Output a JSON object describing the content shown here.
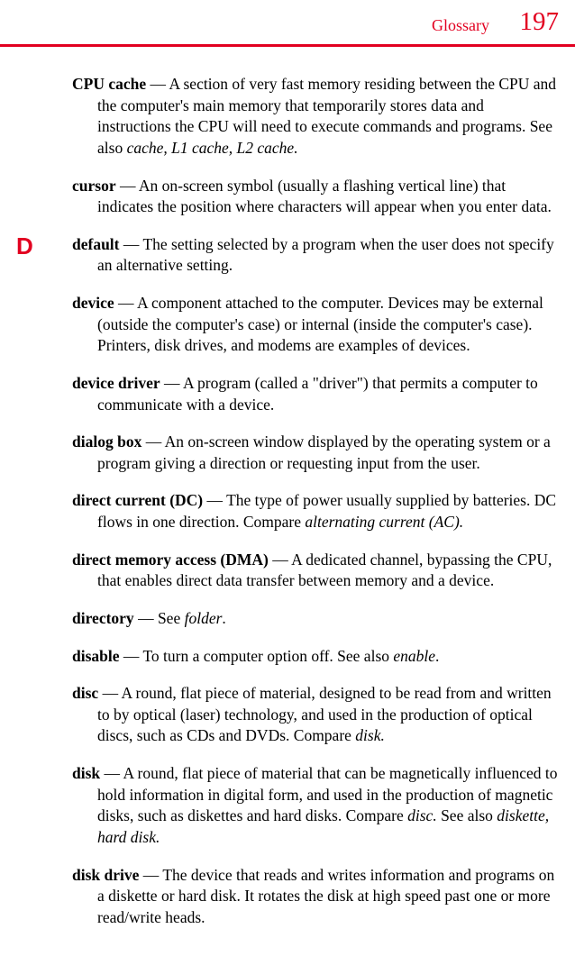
{
  "header": {
    "title": "Glossary",
    "pageNumber": "197"
  },
  "sectionLetter": "D",
  "entries": [
    {
      "term": "CPU cache",
      "sep": " — ",
      "definition": "A section of very fast memory residing between the CPU and the computer's main memory that temporarily stores data and instructions the CPU will need to execute commands and programs. See also ",
      "italic": "cache, L1 cache, L2 cache.",
      "after": ""
    },
    {
      "term": "cursor",
      "sep": " — ",
      "definition": "An on-screen symbol (usually a flashing vertical line) that indicates the position where characters will appear when you enter data.",
      "italic": "",
      "after": ""
    },
    {
      "term": "default",
      "sep": " — ",
      "definition": "The setting selected by a program when the user does not specify an alternative setting.",
      "italic": "",
      "after": ""
    },
    {
      "term": "device",
      "sep": " — ",
      "definition": "A component attached to the computer. Devices may be external (outside the computer's case) or internal (inside the computer's case). Printers, disk drives, and modems are examples of devices.",
      "italic": "",
      "after": ""
    },
    {
      "term": "device driver",
      "sep": " — ",
      "definition": "A program (called a \"driver\") that permits a computer to communicate with a device.",
      "italic": "",
      "after": ""
    },
    {
      "term": "dialog box",
      "sep": " — ",
      "definition": "An on-screen window displayed by the operating system or a program giving a direction or requesting input from the user.",
      "italic": "",
      "after": ""
    },
    {
      "term": "direct current (DC)",
      "sep": " — ",
      "definition": "The type of power usually supplied by batteries. DC flows in one direction. Compare ",
      "italic": "alternating current (AC).",
      "after": ""
    },
    {
      "term": "direct memory access (DMA)",
      "sep": " — ",
      "definition": "A dedicated channel, bypassing the CPU, that enables direct data transfer between memory and a device.",
      "italic": "",
      "after": ""
    },
    {
      "term": "directory",
      "sep": " — ",
      "definition": "See ",
      "italic": "folder",
      "after": "."
    },
    {
      "term": "disable",
      "sep": " — ",
      "definition": "To turn a computer option off. See also ",
      "italic": "enable",
      "after": "."
    },
    {
      "term": "disc",
      "sep": " — ",
      "definition": "A round, flat piece of material, designed to be read from and written to by optical (laser) technology, and used in the production of optical discs, such as CDs and DVDs. Compare ",
      "italic": "disk.",
      "after": ""
    },
    {
      "term": "disk",
      "sep": " — ",
      "definition": "A round, flat piece of material that can be magnetically influenced to hold information in digital form, and used in the production of magnetic disks, such as diskettes and hard disks. Compare ",
      "italic": "disc.",
      "after": " See also ",
      "italic2": "diskette, hard disk.",
      "after2": ""
    },
    {
      "term": "disk drive",
      "sep": " — ",
      "definition": "The device that reads and writes information and programs on a diskette or hard disk. It rotates the disk at high speed past one or more read/write heads.",
      "italic": "",
      "after": ""
    }
  ]
}
